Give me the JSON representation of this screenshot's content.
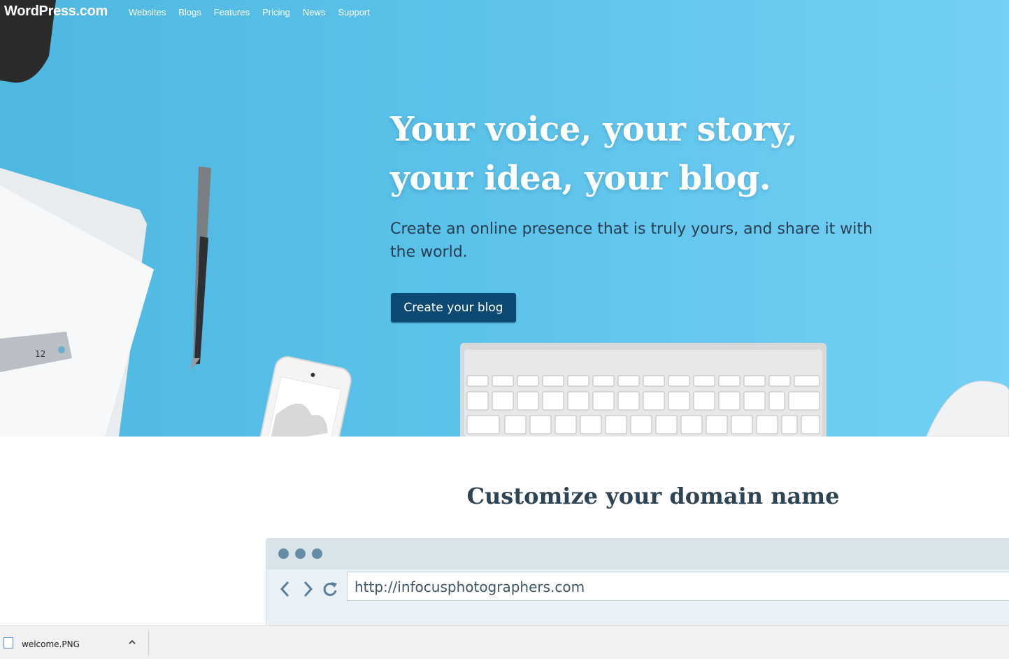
{
  "nav": {
    "logo": "WordPress.com",
    "links": [
      "Websites",
      "Blogs",
      "Features",
      "Pricing",
      "News",
      "Support"
    ]
  },
  "hero": {
    "title_line1": "Your voice, your story,",
    "title_line2": "your idea, your blog.",
    "subtitle": "Create an online presence that is truly yours, and share it with the world.",
    "cta": "Create your blog",
    "ruler_number": "12"
  },
  "domain": {
    "title": "Customize your domain name",
    "url_value": "http://infocusphotographers.com"
  },
  "download_bar": {
    "file_name": "welcome.PNG"
  },
  "colors": {
    "hero_bg": "#5bc2ea",
    "cta_bg": "#0c4a74",
    "heading_text": "#2e4453"
  },
  "icons": [
    "back-arrow-icon",
    "forward-arrow-icon",
    "reload-icon",
    "image-file-icon",
    "chevron-up-icon"
  ]
}
